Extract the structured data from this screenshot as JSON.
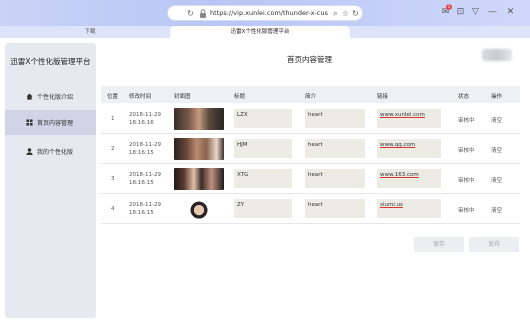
{
  "browser": {
    "url": "https://vip.xunlei.com/thunder-x-custom-ed",
    "tabs": [
      {
        "label": "下载"
      },
      {
        "label": "迅雷X个性化版管理平台"
      }
    ],
    "notification_count": "1"
  },
  "sidebar": {
    "title": "迅雷X个性化版管理平台",
    "items": [
      {
        "label": "个性化版介绍",
        "icon": "home-icon"
      },
      {
        "label": "首页内容管理",
        "icon": "grid-icon"
      },
      {
        "label": "我的个性化版",
        "icon": "user-icon"
      }
    ]
  },
  "main": {
    "title": "首页内容管理",
    "columns": [
      "位置",
      "修改时间",
      "封面图",
      "标题",
      "简介",
      "链接",
      "状态",
      "操作"
    ],
    "rows": [
      {
        "index": "1",
        "date": "2018-11-29",
        "time": "18:16:16",
        "title": "LZX",
        "intro": "heart",
        "link": "www.xunlei.com",
        "status": "审核中",
        "action": "清空"
      },
      {
        "index": "2",
        "date": "2018-11-29",
        "time": "18:16:15",
        "title": "HJM",
        "intro": "heart",
        "link": "www.qq.com",
        "status": "审核中",
        "action": "清空"
      },
      {
        "index": "3",
        "date": "2018-11-29",
        "time": "18:16:15",
        "title": "XTG",
        "intro": "heart",
        "link": "www.163.com",
        "status": "审核中",
        "action": "清空"
      },
      {
        "index": "4",
        "date": "2018-11-29",
        "time": "18:16:15",
        "title": "ZY",
        "intro": "heart",
        "link": "siumi.us",
        "status": "审核中",
        "action": "清空"
      }
    ],
    "save_label": "保存",
    "publish_label": "发布"
  },
  "colors": {
    "accent_chrome": "#c3cef6",
    "active_sidebar": "#d0d4e6",
    "link_underline": "#dd3333"
  }
}
